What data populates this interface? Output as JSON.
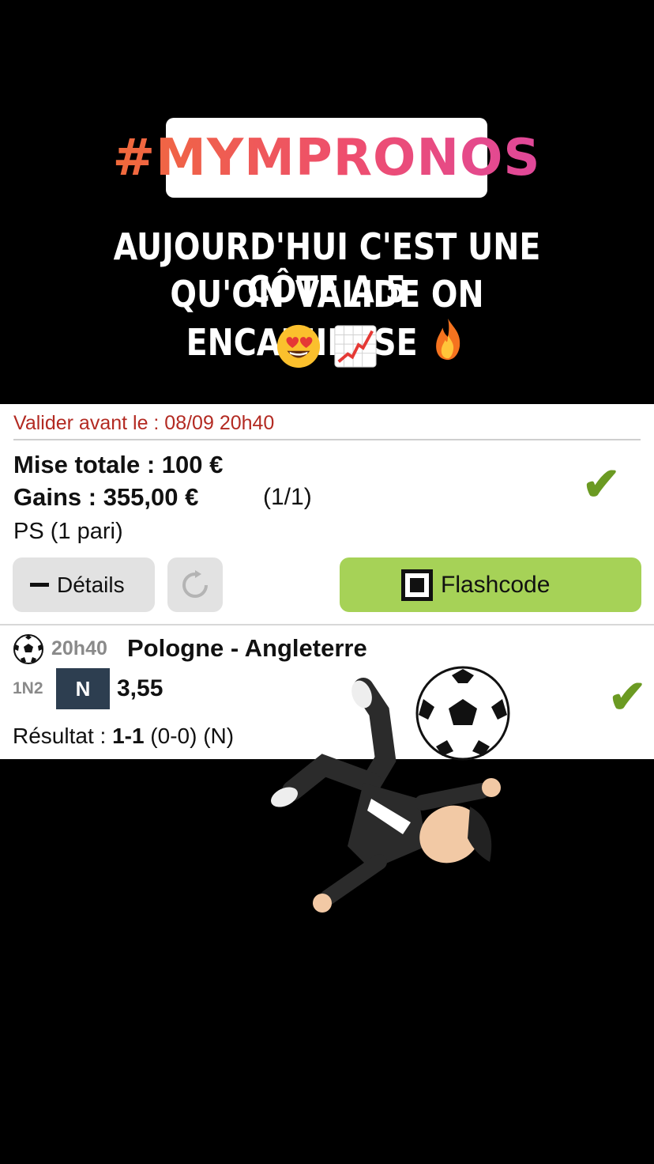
{
  "story": {
    "hashtag": "#MYMPRONOS",
    "caption_line1": "AUJOURD'HUI C'EST UNE CÔTE A 5",
    "caption_line2": "QU'ON VALIDE ON ENCAIIIIIIIISE",
    "emojis": [
      "fire-emoji",
      "heart-eyes-emoji",
      "chart-increasing-emoji"
    ]
  },
  "bet": {
    "deadline": "Valider avant le : 08/09 20h40",
    "stake": "Mise totale : 100 €",
    "gains": "Gains : 355,00 €",
    "ratio": "(1/1)",
    "type": "PS (1 pari)",
    "status": "won",
    "details_label": "Détails",
    "flashcode_label": "Flashcode"
  },
  "match": {
    "time": "20h40",
    "teams": "Pologne - Angleterre",
    "market": "1N2",
    "pick": "N",
    "odds": "3,55",
    "result_label": "Résultat : ",
    "result_score": "1-1",
    "result_rest": " (0-0) (N)",
    "status": "won"
  },
  "colors": {
    "deadline": "#b32a22",
    "check": "#6b9a22",
    "flashcode_button": "#a6d257",
    "pick_badge": "#2d3e50"
  }
}
